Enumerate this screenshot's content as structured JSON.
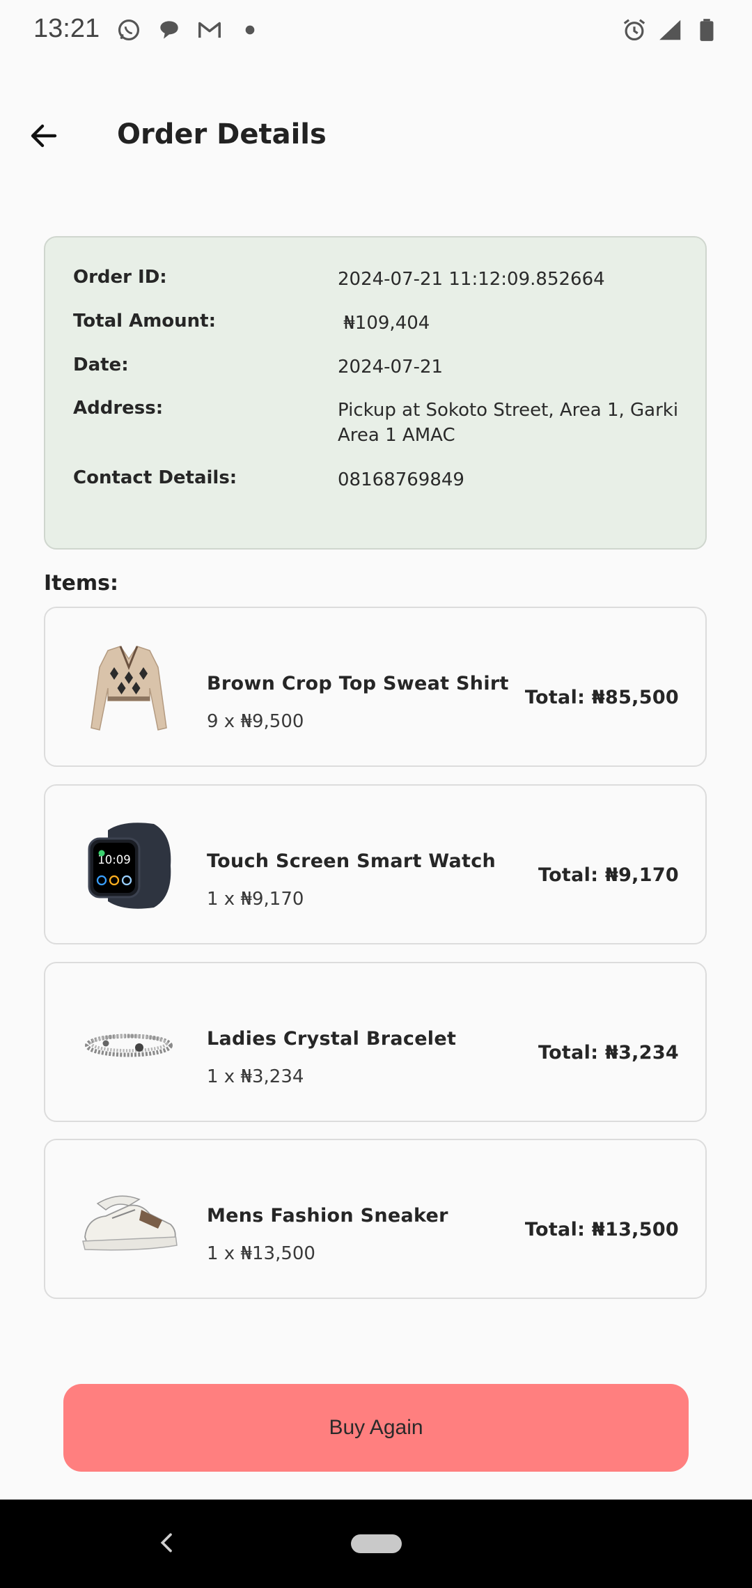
{
  "status_bar": {
    "time": "13:21",
    "left_icons": [
      "whatsapp-icon",
      "chat-bubble-icon",
      "gmail-icon",
      "dot-icon"
    ],
    "right_icons": [
      "alarm-icon",
      "signal-icon",
      "battery-icon"
    ]
  },
  "app_bar": {
    "title": "Order Details",
    "back_icon": "arrow-left-icon"
  },
  "order": {
    "id_label": "Order ID:",
    "id_value": "2024-07-21 11:12:09.852664",
    "total_label": "Total Amount:",
    "total_value": " ₦109,404",
    "date_label": "Date:",
    "date_value": "2024-07-21",
    "address_label": "Address:",
    "address_value": "Pickup at Sokoto Street, Area 1, Garki Area 1 AMAC",
    "contact_label": "Contact Details:",
    "contact_value": "08168769849"
  },
  "items_heading": "Items:",
  "items": [
    {
      "name": "Brown Crop Top Sweat Shirt",
      "qty": "9 x ₦9,500",
      "total": "Total: ₦85,500",
      "thumb": "sweatshirt-thumbnail"
    },
    {
      "name": "Touch Screen Smart Watch",
      "qty": "1 x ₦9,170",
      "total": "Total: ₦9,170",
      "thumb": "smartwatch-thumbnail"
    },
    {
      "name": "Ladies Crystal Bracelet",
      "qty": "1 x ₦3,234",
      "total": "Total: ₦3,234",
      "thumb": "bracelet-thumbnail"
    },
    {
      "name": "Mens Fashion Sneaker",
      "qty": "1 x ₦13,500",
      "total": "Total: ₦13,500",
      "thumb": "sneaker-thumbnail"
    }
  ],
  "buy_again_label": "Buy Again",
  "colors": {
    "summary_bg": "#e8efe7",
    "button_bg": "#ff7f7f",
    "page_bg": "#fafafa"
  }
}
